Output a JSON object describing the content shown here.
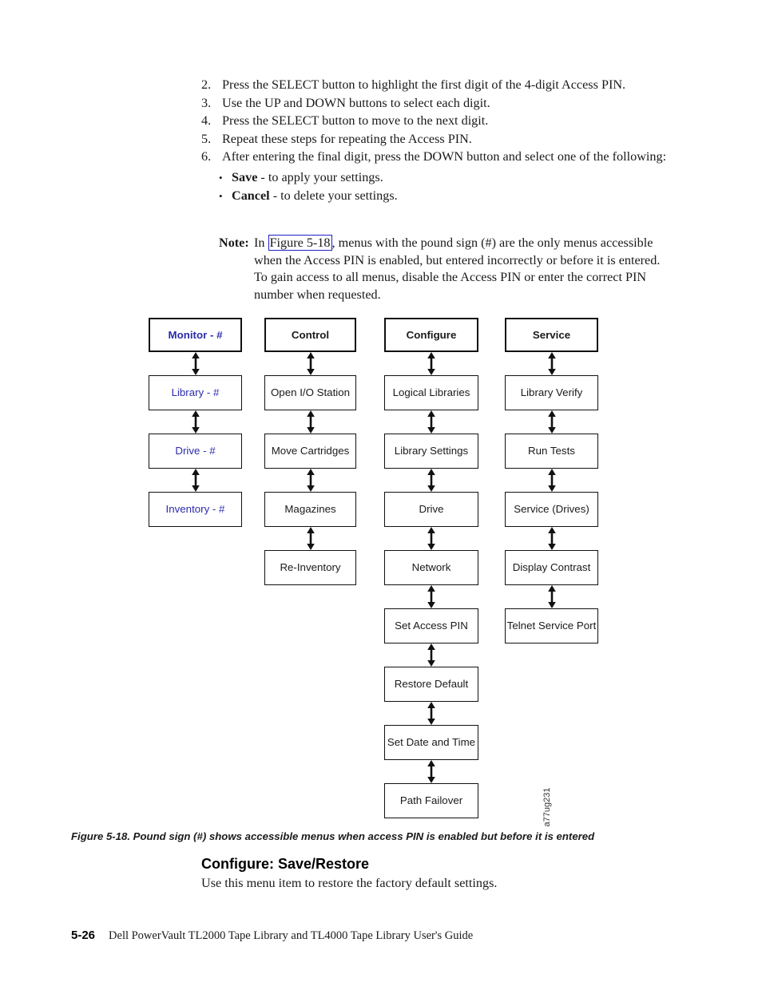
{
  "procedure": {
    "items": [
      {
        "num": "2.",
        "text": "Press the SELECT button to highlight the first digit of the 4-digit Access PIN."
      },
      {
        "num": "3.",
        "text": "Use the UP and DOWN buttons to select each digit."
      },
      {
        "num": "4.",
        "text": "Press the SELECT button to move to the next digit."
      },
      {
        "num": "5.",
        "text": "Repeat these steps for repeating the Access PIN."
      },
      {
        "num": "6.",
        "text": "After entering the final digit, press the DOWN button and select one of the following:"
      }
    ],
    "sub_items": [
      {
        "bullet": "•",
        "term": "Save",
        "rest": " - to apply your settings."
      },
      {
        "bullet": "•",
        "term": "Cancel",
        "rest": " - to delete your settings."
      }
    ]
  },
  "note": {
    "label": "Note:",
    "text_before_link": "In ",
    "link_text": "Figure 5-18",
    "text_after_link": ", menus with the pound sign (#) are the only menus accessible when the Access PIN is enabled, but entered incorrectly or before it is entered. To gain access to all menus, disable the Access PIN or enter the correct PIN number when requested."
  },
  "diagram": {
    "accent_blue": "#2b2bad",
    "figure_id": "a77ug231",
    "columns": [
      {
        "id": "monitor",
        "blue": true,
        "nodes": [
          {
            "label": "Monitor - #",
            "header": true
          },
          {
            "label": "Library - #"
          },
          {
            "label": "Drive - #"
          },
          {
            "label": "Inventory - #"
          }
        ]
      },
      {
        "id": "control",
        "blue": false,
        "nodes": [
          {
            "label": "Control",
            "header": true
          },
          {
            "label": "Open I/O Station"
          },
          {
            "label": "Move Cartridges"
          },
          {
            "label": "Magazines"
          },
          {
            "label": "Re-Inventory"
          }
        ]
      },
      {
        "id": "configure",
        "blue": false,
        "nodes": [
          {
            "label": "Configure",
            "header": true
          },
          {
            "label": "Logical Libraries"
          },
          {
            "label": "Library Settings"
          },
          {
            "label": "Drive"
          },
          {
            "label": "Network"
          },
          {
            "label": "Set Access PIN"
          },
          {
            "label": "Restore Default"
          },
          {
            "label": "Set Date and Time"
          },
          {
            "label": "Path Failover"
          }
        ]
      },
      {
        "id": "service",
        "blue": false,
        "nodes": [
          {
            "label": "Service",
            "header": true
          },
          {
            "label": "Library Verify"
          },
          {
            "label": "Run Tests"
          },
          {
            "label": "Service (Drives)"
          },
          {
            "label": "Display Contrast"
          },
          {
            "label": "Telnet Service Port"
          }
        ]
      }
    ]
  },
  "figure_caption": "Figure 5-18. Pound sign (#) shows accessible menus when access PIN is enabled but before it is entered",
  "section": {
    "heading": "Configure: Save/Restore",
    "body": "Use this menu item to restore the factory default settings."
  },
  "footer": {
    "page_number": "5-26",
    "title": "Dell PowerVault TL2000 Tape Library and TL4000 Tape Library User's Guide"
  }
}
